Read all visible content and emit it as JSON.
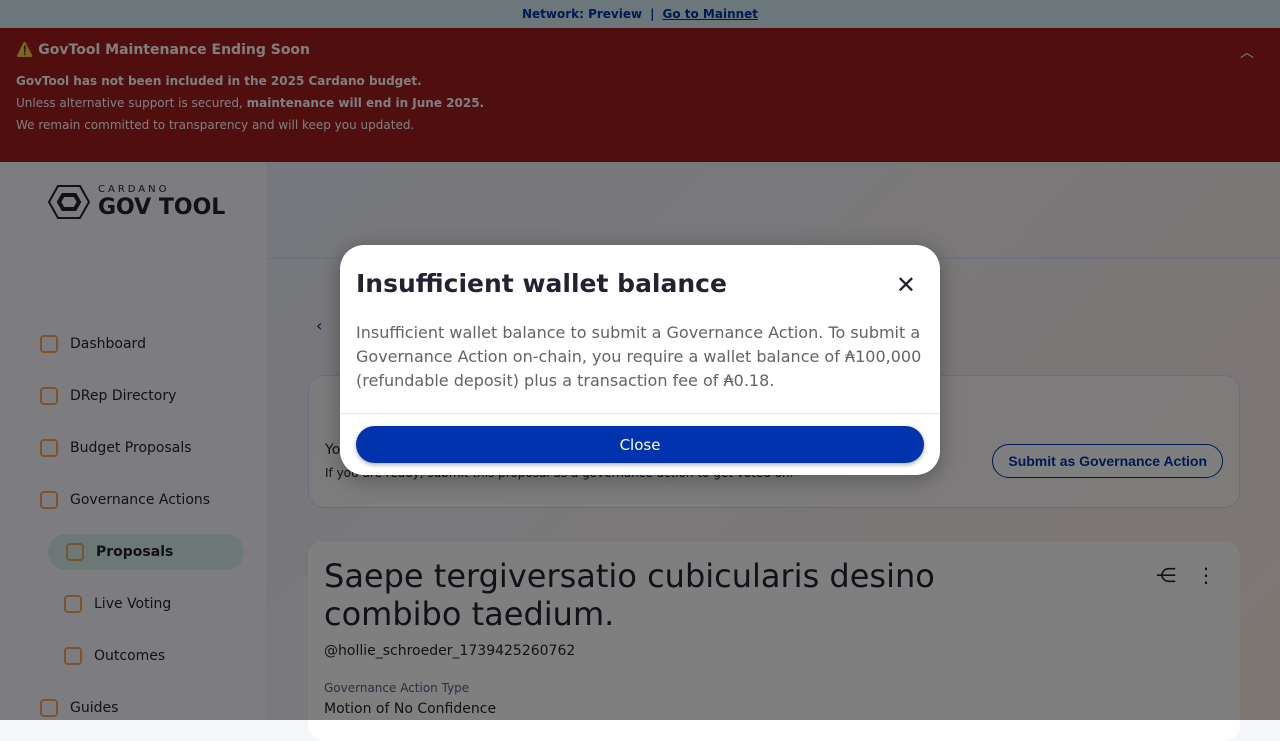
{
  "network": {
    "label": "Network: Preview",
    "sep": "|",
    "link": "Go to Mainnet"
  },
  "maintenance": {
    "title": "⚠️ GovTool Maintenance Ending Soon",
    "line1": "GovTool has not been included in the 2025 Cardano budget.",
    "line2a": "Unless alternative support is secured, ",
    "line2b": "maintenance will end in June 2025.",
    "line3": "We remain committed to transparency and will keep you updated."
  },
  "logo": {
    "top": "CARDANO",
    "main": "GOV TOOL"
  },
  "nav": [
    "Dashboard",
    "DRep Directory",
    "Budget Proposals",
    "Governance Actions",
    "Proposals",
    "Live Voting",
    "Outcomes",
    "Guides"
  ],
  "card1": {
    "t1": "Yo",
    "t2": "If you are ready, submit this proposal as a governance action to get voted on.",
    "button": "Submit as Governance Action"
  },
  "proposal": {
    "title": "Saepe tergiversatio cubicularis desino combibo taedium.",
    "author": "@hollie_schroeder_1739425260762",
    "type_label": "Governance Action Type",
    "type_value": "Motion of No Confidence"
  },
  "modal": {
    "title": "Insufficient wallet balance",
    "body": "Insufficient wallet balance to submit a Governance Action. To submit a Governance Action on-chain, you require a wallet balance of ₳100,000 (refundable deposit) plus a transaction fee of ₳0.18.",
    "close": "Close"
  }
}
